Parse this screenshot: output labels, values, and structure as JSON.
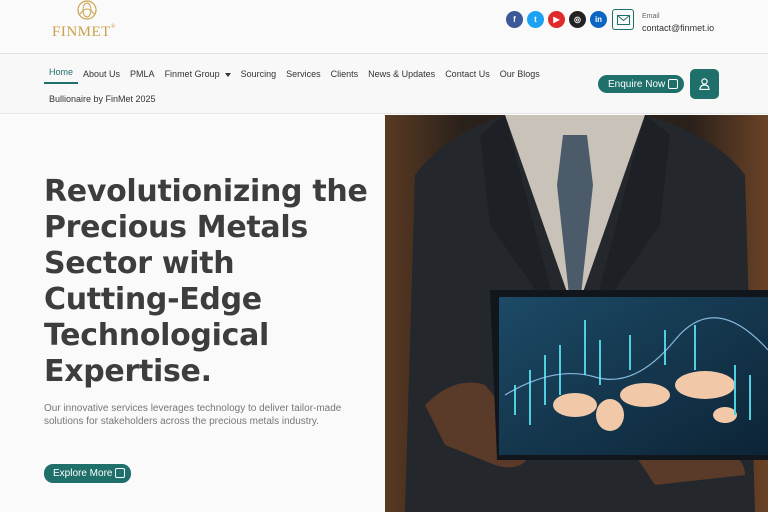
{
  "brand": {
    "name": "FINMET",
    "registered": "®",
    "gold": "#c9a24a"
  },
  "colors": {
    "accent": "#1f6f6a",
    "text": "#3d3d3d"
  },
  "socials": [
    {
      "name": "facebook-icon",
      "glyph": "f",
      "color": "#3b5998"
    },
    {
      "name": "twitter-icon",
      "glyph": "t",
      "color": "#1da1f2"
    },
    {
      "name": "youtube-icon",
      "glyph": "▶",
      "color": "#e02b2b"
    },
    {
      "name": "instagram-icon",
      "glyph": "◎",
      "color": "#222222"
    },
    {
      "name": "linkedin-icon",
      "glyph": "in",
      "color": "#0a66c2"
    }
  ],
  "contact": {
    "label": "Email",
    "email": "contact@finmet.io"
  },
  "nav": {
    "items": [
      "Home",
      "About Us",
      "PMLA",
      "Finmet Group",
      "Sourcing",
      "Services",
      "Clients",
      "News & Updates",
      "Contact Us",
      "Our Blogs"
    ],
    "active": "Home",
    "second_row": "Bullionaire by FinMet 2025",
    "enquire_label": "Enquire Now"
  },
  "hero": {
    "title": "Revolutionizing the Precious Metals Sector with Cutting-Edge Technological Expertise.",
    "subtitle": "Our innovative services leverages technology to deliver tailor-made solutions for stakeholders across the precious metals industry.",
    "cta_label": "Explore More"
  }
}
